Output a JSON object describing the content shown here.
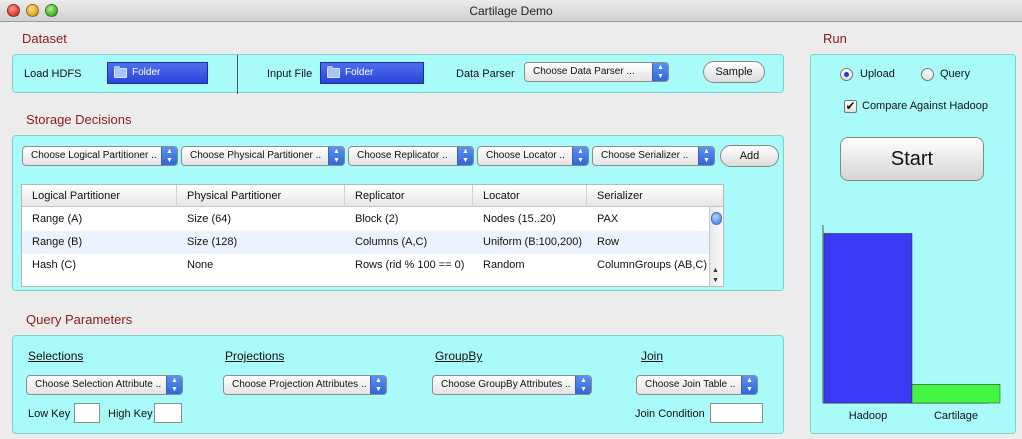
{
  "window": {
    "title": "Cartilage Demo"
  },
  "dataset": {
    "section_title": "Dataset",
    "load_hdfs_label": "Load HDFS",
    "load_hdfs_button": "Folder",
    "input_file_label": "Input File",
    "input_file_button": "Folder",
    "data_parser_label": "Data Parser",
    "data_parser_select": "Choose Data Parser ...",
    "sample_button": "Sample"
  },
  "storage": {
    "section_title": "Storage Decisions",
    "selects": [
      "Choose Logical Partitioner ..",
      "Choose Physical Partitioner ..",
      "Choose Replicator ..",
      "Choose Locator ..",
      "Choose Serializer .."
    ],
    "add_button": "Add",
    "columns": [
      "Logical Partitioner",
      "Physical Partitioner",
      "Replicator",
      "Locator",
      "Serializer"
    ],
    "rows": [
      [
        "Range (A)",
        "Size (64)",
        "Block (2)",
        "Nodes (15..20)",
        "PAX"
      ],
      [
        "Range (B)",
        "Size (128)",
        "Columns (A,C)",
        "Uniform (B:100,200)",
        "Row"
      ],
      [
        "Hash (C)",
        "None",
        "Rows (rid % 100 == 0)",
        "Random",
        "ColumnGroups (AB,C)"
      ]
    ]
  },
  "query": {
    "section_title": "Query Parameters",
    "selections_heading": "Selections",
    "projections_heading": "Projections",
    "groupby_heading": "GroupBy",
    "join_heading": "Join",
    "selection_select": "Choose Selection Attribute ..",
    "projection_select": "Choose Projection Attributes ..",
    "groupby_select": "Choose GroupBy Attributes ..",
    "join_select": "Choose Join Table ..",
    "low_key_label": "Low Key",
    "high_key_label": "High Key",
    "join_condition_label": "Join Condition"
  },
  "run": {
    "section_title": "Run",
    "upload_label": "Upload",
    "query_label": "Query",
    "mode_selected": "Upload",
    "compare_label": "Compare Against Hadoop",
    "compare_checked": true,
    "start_button": "Start",
    "check_mark": "✔"
  },
  "chart_data": {
    "type": "bar",
    "categories": [
      "Hadoop",
      "Cartilage"
    ],
    "values": [
      100,
      11
    ],
    "ylim": [
      0,
      105
    ],
    "colors": [
      "#3b3bf5",
      "#44f544"
    ]
  }
}
